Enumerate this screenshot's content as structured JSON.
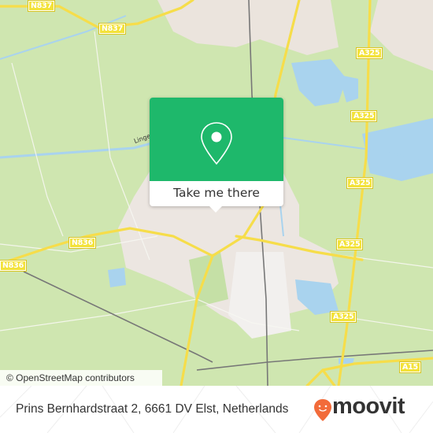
{
  "map": {
    "attribution": "© OpenStreetMap contributors",
    "place_labels": [
      "Linge"
    ],
    "road_shields": [
      {
        "label": "N837",
        "id": "n837-a"
      },
      {
        "label": "N837",
        "id": "n837-b"
      },
      {
        "label": "N836",
        "id": "n836-a"
      },
      {
        "label": "N836",
        "id": "n836-b"
      },
      {
        "label": "A325",
        "id": "a325-a"
      },
      {
        "label": "A325",
        "id": "a325-b"
      },
      {
        "label": "A325",
        "id": "a325-c"
      },
      {
        "label": "A325",
        "id": "a325-d"
      },
      {
        "label": "A325",
        "id": "a325-e"
      },
      {
        "label": "A15",
        "id": "a15"
      }
    ],
    "colors": {
      "land": "#cfe6b0",
      "urban": "#ece6e1",
      "water": "#a9d3ee",
      "road": "#f6dd4a",
      "rail": "#777777"
    }
  },
  "popup": {
    "icon": "map-pin-icon",
    "button_label": "Take me there",
    "accent": "#1eb86b"
  },
  "footer": {
    "address": "Prins Bernhardstraat 2, 6661 DV Elst, Netherlands",
    "logo_text": "moovit",
    "logo_color": "#f26b3a"
  }
}
